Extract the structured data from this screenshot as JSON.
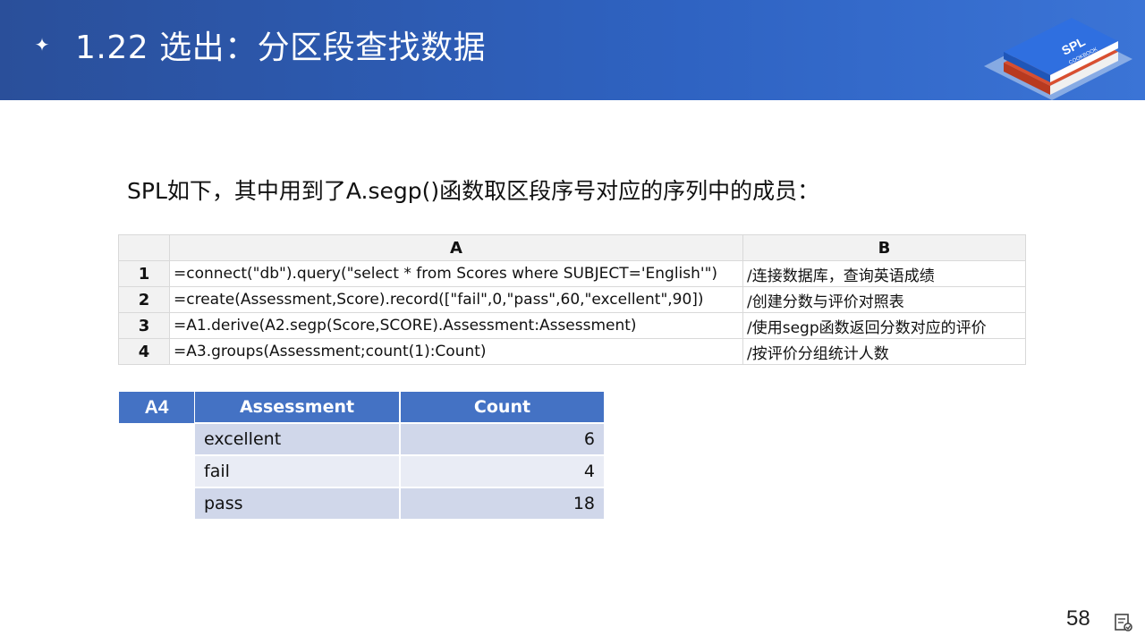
{
  "header": {
    "title": "1.22  选出：分区段查找数据",
    "sparkle_icon": "four-point-star-icon",
    "logo": {
      "icon": "spl-cookbook-logo",
      "text": "SPL",
      "subtext": "COOKBOOK"
    }
  },
  "intro": "SPL如下，其中用到了A.segp()函数取区段序号对应的序列中的成员：",
  "code_table": {
    "headers": [
      "A",
      "B"
    ],
    "rows": [
      {
        "num": "1",
        "a": "=connect(\"db\").query(\"select * from Scores where SUBJECT='English'\")",
        "b": "/连接数据库，查询英语成绩"
      },
      {
        "num": "2",
        "a": "=create(Assessment,Score).record([\"fail\",0,\"pass\",60,\"excellent\",90])",
        "b": "/创建分数与评价对照表"
      },
      {
        "num": "3",
        "a": "=A1.derive(A2.segp(Score,SCORE).Assessment:Assessment)",
        "b": "/使用segp函数返回分数对应的评价"
      },
      {
        "num": "4",
        "a": "=A3.groups(Assessment;count(1):Count)",
        "b": "/按评价分组统计人数"
      }
    ]
  },
  "result": {
    "label": "A4",
    "headers": [
      "Assessment",
      "Count"
    ],
    "rows": [
      {
        "assessment": "excellent",
        "count": "6"
      },
      {
        "assessment": "fail",
        "count": "4"
      },
      {
        "assessment": "pass",
        "count": "18"
      }
    ]
  },
  "footer": {
    "page_number": "58",
    "icon": "presenter-view-icon"
  }
}
